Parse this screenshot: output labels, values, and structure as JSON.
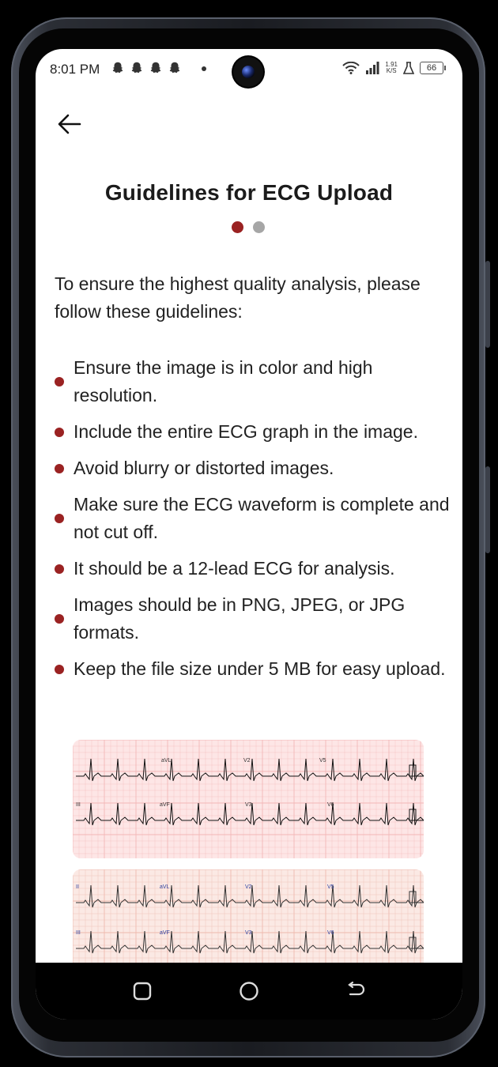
{
  "status_bar": {
    "time": "8:01 PM",
    "notification_icons": [
      "snapchat-icon",
      "snapchat-icon",
      "snapchat-icon",
      "snapchat-icon"
    ],
    "net_speed_value": "1.91",
    "net_speed_unit": "K/S",
    "battery": "66"
  },
  "header": {
    "back_icon": "arrow-left-icon",
    "title": "Guidelines for ECG Upload"
  },
  "pager": {
    "total": 2,
    "active": 1
  },
  "intro": "To ensure the highest quality analysis, please follow these guidelines:",
  "guidelines": [
    "Ensure the image is in color and high resolution.",
    "Include the entire ECG graph in the image.",
    "Avoid blurry or distorted images.",
    "Make sure the ECG waveform is complete and not cut off.",
    "It should be a 12-lead ECG for analysis.",
    "Images should be in PNG, JPEG, or JPG formats.",
    "Keep the file size under 5 MB for easy upload."
  ],
  "examples": [
    {
      "name": "ecg-example-1",
      "row1_labels": [
        "aVL",
        "V2",
        "V5"
      ],
      "row2_labels": [
        "III",
        "aVF",
        "V3",
        "V6"
      ]
    },
    {
      "name": "ecg-example-2",
      "row1_labels": [
        "II",
        "aVL",
        "V2",
        "V5"
      ],
      "row2_labels": [
        "III",
        "aVF",
        "V3",
        "V6"
      ]
    }
  ],
  "colors": {
    "accent": "#9a2222",
    "pager_inactive": "#a6a6a6",
    "ecg_grid_bg_1": "#fde6e6",
    "ecg_grid_bg_2": "#fbe9e4"
  },
  "nav_bar": {
    "icons": [
      "recent-apps-icon",
      "home-icon",
      "back-icon"
    ]
  }
}
